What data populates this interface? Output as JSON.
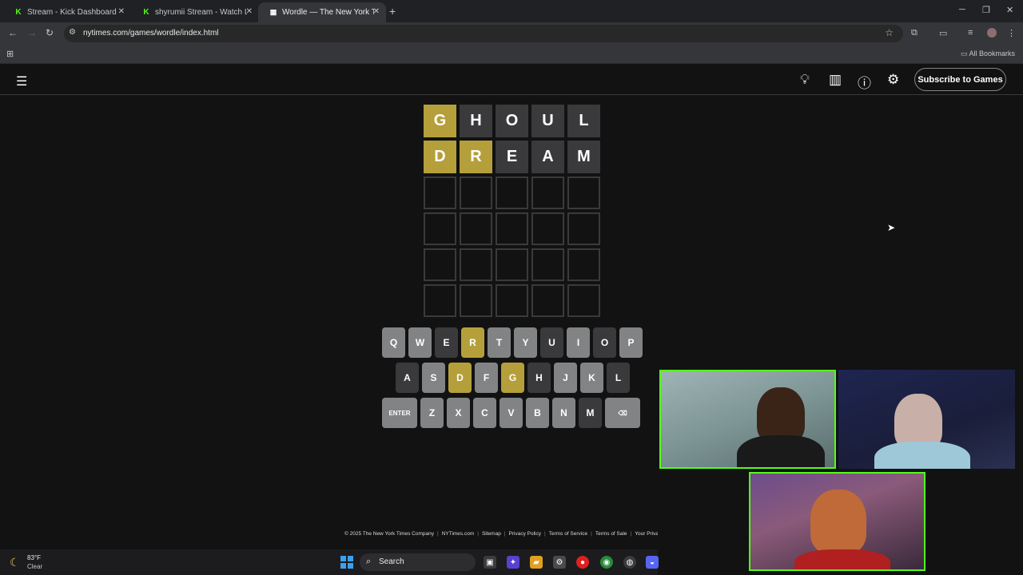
{
  "browser": {
    "tabs": [
      {
        "title": "Stream - Kick Dashboard",
        "favicon": "kick-icon"
      },
      {
        "title": "shyrumii Stream - Watch Live on Kick",
        "favicon": "kick-icon"
      },
      {
        "title": "Wordle — The New York Times",
        "favicon": "wordle-icon",
        "active": true
      }
    ],
    "url": "nytimes.com/games/wordle/index.html",
    "bookmarks_label": "All Bookmarks"
  },
  "header": {
    "subscribe_label": "Subscribe to Games",
    "icons": [
      "menu-icon",
      "hint-icon",
      "stats-icon",
      "help-icon",
      "settings-icon"
    ]
  },
  "board": {
    "rows": [
      [
        {
          "l": "G",
          "s": "present"
        },
        {
          "l": "H",
          "s": "absent"
        },
        {
          "l": "O",
          "s": "absent"
        },
        {
          "l": "U",
          "s": "absent"
        },
        {
          "l": "L",
          "s": "absent"
        }
      ],
      [
        {
          "l": "D",
          "s": "present"
        },
        {
          "l": "R",
          "s": "present"
        },
        {
          "l": "E",
          "s": "absent"
        },
        {
          "l": "A",
          "s": "absent"
        },
        {
          "l": "M",
          "s": "absent"
        }
      ],
      [
        {
          "l": "",
          "s": "empty"
        },
        {
          "l": "",
          "s": "empty"
        },
        {
          "l": "",
          "s": "empty"
        },
        {
          "l": "",
          "s": "empty"
        },
        {
          "l": "",
          "s": "empty"
        }
      ],
      [
        {
          "l": "",
          "s": "empty"
        },
        {
          "l": "",
          "s": "empty"
        },
        {
          "l": "",
          "s": "empty"
        },
        {
          "l": "",
          "s": "empty"
        },
        {
          "l": "",
          "s": "empty"
        }
      ],
      [
        {
          "l": "",
          "s": "empty"
        },
        {
          "l": "",
          "s": "empty"
        },
        {
          "l": "",
          "s": "empty"
        },
        {
          "l": "",
          "s": "empty"
        },
        {
          "l": "",
          "s": "empty"
        }
      ],
      [
        {
          "l": "",
          "s": "empty"
        },
        {
          "l": "",
          "s": "empty"
        },
        {
          "l": "",
          "s": "empty"
        },
        {
          "l": "",
          "s": "empty"
        },
        {
          "l": "",
          "s": "empty"
        }
      ]
    ]
  },
  "keyboard": {
    "rows": [
      [
        {
          "k": "Q",
          "s": "unused"
        },
        {
          "k": "W",
          "s": "unused"
        },
        {
          "k": "E",
          "s": "absent"
        },
        {
          "k": "R",
          "s": "present"
        },
        {
          "k": "T",
          "s": "unused"
        },
        {
          "k": "Y",
          "s": "unused"
        },
        {
          "k": "U",
          "s": "absent"
        },
        {
          "k": "I",
          "s": "unused"
        },
        {
          "k": "O",
          "s": "absent"
        },
        {
          "k": "P",
          "s": "unused"
        }
      ],
      [
        {
          "k": "A",
          "s": "absent"
        },
        {
          "k": "S",
          "s": "unused"
        },
        {
          "k": "D",
          "s": "present"
        },
        {
          "k": "F",
          "s": "unused"
        },
        {
          "k": "G",
          "s": "present"
        },
        {
          "k": "H",
          "s": "absent"
        },
        {
          "k": "J",
          "s": "unused"
        },
        {
          "k": "K",
          "s": "unused"
        },
        {
          "k": "L",
          "s": "absent"
        }
      ],
      [
        {
          "k": "ENTER",
          "s": "unused",
          "wide": true
        },
        {
          "k": "Z",
          "s": "unused"
        },
        {
          "k": "X",
          "s": "unused"
        },
        {
          "k": "C",
          "s": "unused"
        },
        {
          "k": "V",
          "s": "unused"
        },
        {
          "k": "B",
          "s": "unused"
        },
        {
          "k": "N",
          "s": "unused"
        },
        {
          "k": "M",
          "s": "absent"
        },
        {
          "k": "⌫",
          "s": "unused",
          "wide": true
        }
      ]
    ]
  },
  "footer": {
    "links": [
      "© 2025 The New York Times Company",
      "NYTimes.com",
      "Sitemap",
      "Privacy Policy",
      "Terms of Service",
      "Terms of Sale",
      "Your Privacy"
    ]
  },
  "taskbar": {
    "temperature": "83°F",
    "condition": "Clear",
    "search_label": "Search"
  },
  "colors": {
    "present": "#b59f3b",
    "absent": "#3a3a3c",
    "unused_key": "#818384",
    "kick_green": "#53fc18"
  }
}
